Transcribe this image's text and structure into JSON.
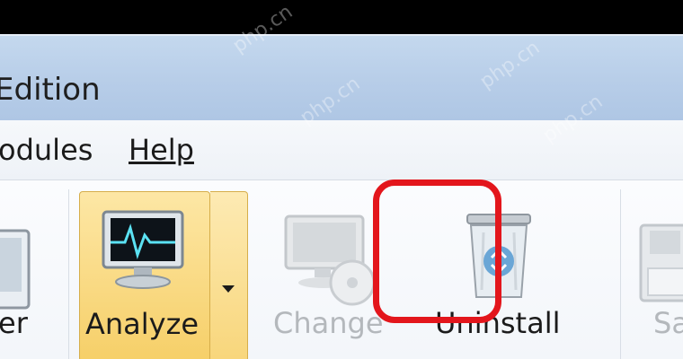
{
  "window": {
    "title": "Edition"
  },
  "menu": {
    "items": [
      {
        "label": "odules"
      },
      {
        "label": "Help"
      }
    ]
  },
  "toolbar": {
    "left_partial_label": "er",
    "analyze_label": "Analyze",
    "change_label": "Change",
    "uninstall_label": "Uninstall",
    "right_partial_label": "Sa"
  },
  "watermark": {
    "text": "php.cn"
  },
  "colors": {
    "highlight": "#e3161c",
    "analyze_bg": "#f6cf68",
    "titlebar": "#b7cde8"
  }
}
